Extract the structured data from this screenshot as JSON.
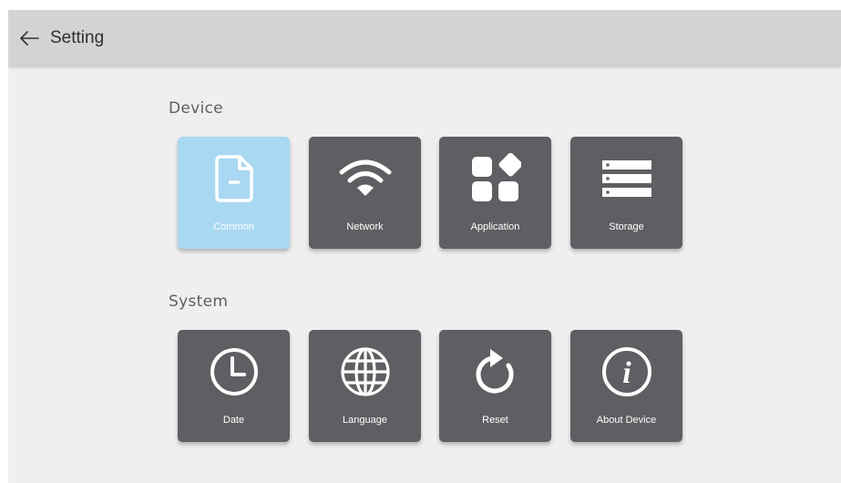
{
  "header": {
    "title": "Setting",
    "back_icon": "arrow-left-icon"
  },
  "sections": [
    {
      "label": "Device",
      "tiles": [
        {
          "label": "Common",
          "icon": "document-icon",
          "selected": true
        },
        {
          "label": "Network",
          "icon": "wifi-icon",
          "selected": false
        },
        {
          "label": "Application",
          "icon": "apps-grid-icon",
          "selected": false
        },
        {
          "label": "Storage",
          "icon": "storage-icon",
          "selected": false
        }
      ]
    },
    {
      "label": "System",
      "tiles": [
        {
          "label": "Date",
          "icon": "clock-icon",
          "selected": false
        },
        {
          "label": "Language",
          "icon": "globe-icon",
          "selected": false
        },
        {
          "label": "Reset",
          "icon": "refresh-icon",
          "selected": false
        },
        {
          "label": "About Device",
          "icon": "info-icon",
          "selected": false
        }
      ]
    }
  ],
  "colors": {
    "tile": "#5d5f62",
    "tile_selected": "#a9d8f2",
    "topbar": "#d3d3d3",
    "background": "#efefef"
  }
}
